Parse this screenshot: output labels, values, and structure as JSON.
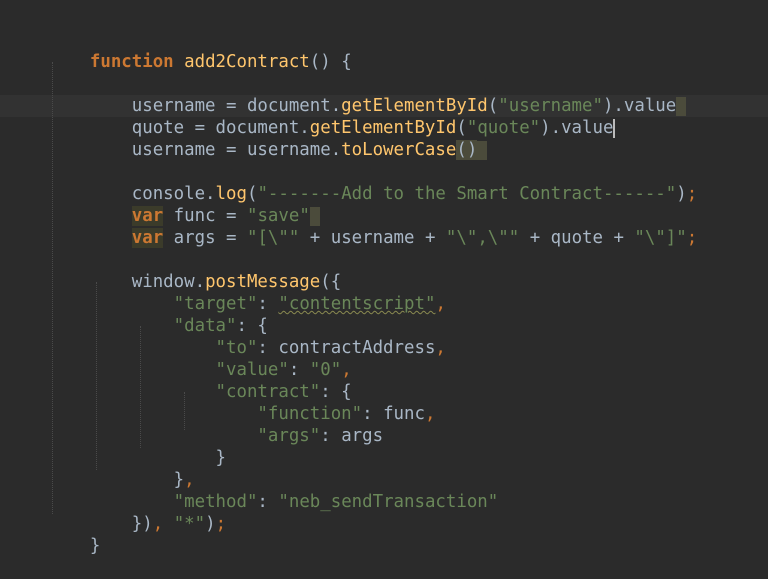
{
  "editor": {
    "language": "javascript",
    "colors": {
      "background": "#2b2b2b",
      "keyword": "#cc7832",
      "function_call": "#ffc66d",
      "string": "#6a8759",
      "text": "#a9b7c6"
    },
    "lines": [
      {
        "tokens": [
          {
            "t": "kw",
            "v": "function"
          },
          {
            "t": "plain",
            "v": " "
          },
          {
            "t": "fn",
            "v": "add2Contract"
          },
          {
            "t": "plain",
            "v": "() {"
          }
        ]
      },
      {
        "tokens": [
          {
            "t": "plain",
            "v": "    username = document."
          },
          {
            "t": "fn",
            "v": "getElementById"
          },
          {
            "t": "plain",
            "v": "("
          },
          {
            "t": "str",
            "v": "\"username\""
          },
          {
            "t": "plain",
            "v": ").value"
          }
        ]
      },
      {
        "tokens": [
          {
            "t": "plain",
            "v": "    quote = document."
          },
          {
            "t": "fn",
            "v": "getElementById"
          },
          {
            "t": "plain",
            "v": "("
          },
          {
            "t": "str",
            "v": "\"quote\""
          },
          {
            "t": "plain",
            "v": ").value"
          }
        ]
      },
      {
        "tokens": [
          {
            "t": "plain",
            "v": "    username = username."
          },
          {
            "t": "fn",
            "v": "toLowerCase"
          },
          {
            "t": "plain",
            "v": "()"
          }
        ]
      },
      {
        "tokens": [
          {
            "t": "plain",
            "v": "    console."
          },
          {
            "t": "fn",
            "v": "log"
          },
          {
            "t": "plain",
            "v": "("
          },
          {
            "t": "str",
            "v": "\"-------Add to the Smart Contract------\""
          },
          {
            "t": "plain",
            "v": ")"
          },
          {
            "t": "punc",
            "v": ";"
          }
        ]
      },
      {
        "tokens": [
          {
            "t": "plain",
            "v": "    "
          },
          {
            "t": "var",
            "v": "var"
          },
          {
            "t": "plain",
            "v": " func = "
          },
          {
            "t": "str",
            "v": "\"save\""
          }
        ]
      },
      {
        "tokens": [
          {
            "t": "plain",
            "v": "    "
          },
          {
            "t": "var",
            "v": "var"
          },
          {
            "t": "plain",
            "v": " args = "
          },
          {
            "t": "str",
            "v": "\"[\\\"\""
          },
          {
            "t": "plain",
            "v": " + username + "
          },
          {
            "t": "str",
            "v": "\"\\\",\\\"\""
          },
          {
            "t": "plain",
            "v": " + quote + "
          },
          {
            "t": "str",
            "v": "\"\\\"]\""
          },
          {
            "t": "punc",
            "v": ";"
          }
        ]
      },
      {
        "tokens": [
          {
            "t": "plain",
            "v": "    window."
          },
          {
            "t": "fn",
            "v": "postMessage"
          },
          {
            "t": "plain",
            "v": "({"
          }
        ]
      },
      {
        "tokens": [
          {
            "t": "plain",
            "v": "        "
          },
          {
            "t": "str",
            "v": "\"target\""
          },
          {
            "t": "plain",
            "v": ": "
          },
          {
            "t": "str",
            "v": "\"contentscript\""
          },
          {
            "t": "punc",
            "v": ","
          }
        ]
      },
      {
        "tokens": [
          {
            "t": "plain",
            "v": "        "
          },
          {
            "t": "str",
            "v": "\"data\""
          },
          {
            "t": "plain",
            "v": ": {"
          }
        ]
      },
      {
        "tokens": [
          {
            "t": "plain",
            "v": "            "
          },
          {
            "t": "str",
            "v": "\"to\""
          },
          {
            "t": "plain",
            "v": ": contractAddress"
          },
          {
            "t": "punc",
            "v": ","
          }
        ]
      },
      {
        "tokens": [
          {
            "t": "plain",
            "v": "            "
          },
          {
            "t": "str",
            "v": "\"value\""
          },
          {
            "t": "plain",
            "v": ": "
          },
          {
            "t": "str",
            "v": "\"0\""
          },
          {
            "t": "punc",
            "v": ","
          }
        ]
      },
      {
        "tokens": [
          {
            "t": "plain",
            "v": "            "
          },
          {
            "t": "str",
            "v": "\"contract\""
          },
          {
            "t": "plain",
            "v": ": {"
          }
        ]
      },
      {
        "tokens": [
          {
            "t": "plain",
            "v": "                "
          },
          {
            "t": "str",
            "v": "\"function\""
          },
          {
            "t": "plain",
            "v": ": func"
          },
          {
            "t": "punc",
            "v": ","
          }
        ]
      },
      {
        "tokens": [
          {
            "t": "plain",
            "v": "                "
          },
          {
            "t": "str",
            "v": "\"args\""
          },
          {
            "t": "plain",
            "v": ": args"
          }
        ]
      },
      {
        "tokens": [
          {
            "t": "plain",
            "v": "            }"
          }
        ]
      },
      {
        "tokens": [
          {
            "t": "plain",
            "v": "        }"
          },
          {
            "t": "punc",
            "v": ","
          }
        ]
      },
      {
        "tokens": [
          {
            "t": "plain",
            "v": "        "
          },
          {
            "t": "str",
            "v": "\"method\""
          },
          {
            "t": "plain",
            "v": ": "
          },
          {
            "t": "str",
            "v": "\"neb_sendTransaction\""
          }
        ]
      },
      {
        "tokens": [
          {
            "t": "plain",
            "v": "    })"
          },
          {
            "t": "punc",
            "v": ","
          },
          {
            "t": "plain",
            "v": " "
          },
          {
            "t": "str",
            "v": "\"*\""
          },
          {
            "t": "plain",
            "v": ")"
          },
          {
            "t": "punc",
            "v": ";"
          }
        ]
      },
      {
        "tokens": [
          {
            "t": "plain",
            "v": "}"
          }
        ]
      }
    ]
  }
}
